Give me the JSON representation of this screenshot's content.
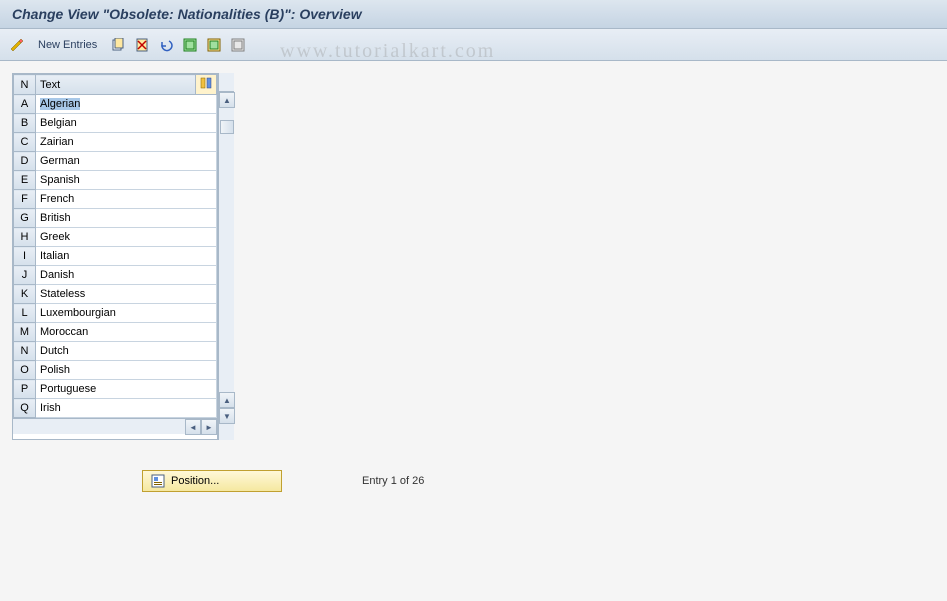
{
  "title": "Change View \"Obsolete: Nationalities (B)\": Overview",
  "toolbar": {
    "new_entries": "New Entries"
  },
  "watermark": "www.tutorialkart.com",
  "table": {
    "headers": {
      "n": "N",
      "text": "Text"
    },
    "rows": [
      {
        "key": "A",
        "text": "Algerian"
      },
      {
        "key": "B",
        "text": "Belgian"
      },
      {
        "key": "C",
        "text": "Zairian"
      },
      {
        "key": "D",
        "text": "German"
      },
      {
        "key": "E",
        "text": "Spanish"
      },
      {
        "key": "F",
        "text": "French"
      },
      {
        "key": "G",
        "text": "British"
      },
      {
        "key": "H",
        "text": "Greek"
      },
      {
        "key": "I",
        "text": "Italian"
      },
      {
        "key": "J",
        "text": "Danish"
      },
      {
        "key": "K",
        "text": "Stateless"
      },
      {
        "key": "L",
        "text": "Luxembourgian"
      },
      {
        "key": "M",
        "text": "Moroccan"
      },
      {
        "key": "N",
        "text": "Dutch"
      },
      {
        "key": "O",
        "text": "Polish"
      },
      {
        "key": "P",
        "text": "Portuguese"
      },
      {
        "key": "Q",
        "text": "Irish"
      }
    ]
  },
  "footer": {
    "position_label": "Position...",
    "entry_text": "Entry 1 of 26"
  }
}
